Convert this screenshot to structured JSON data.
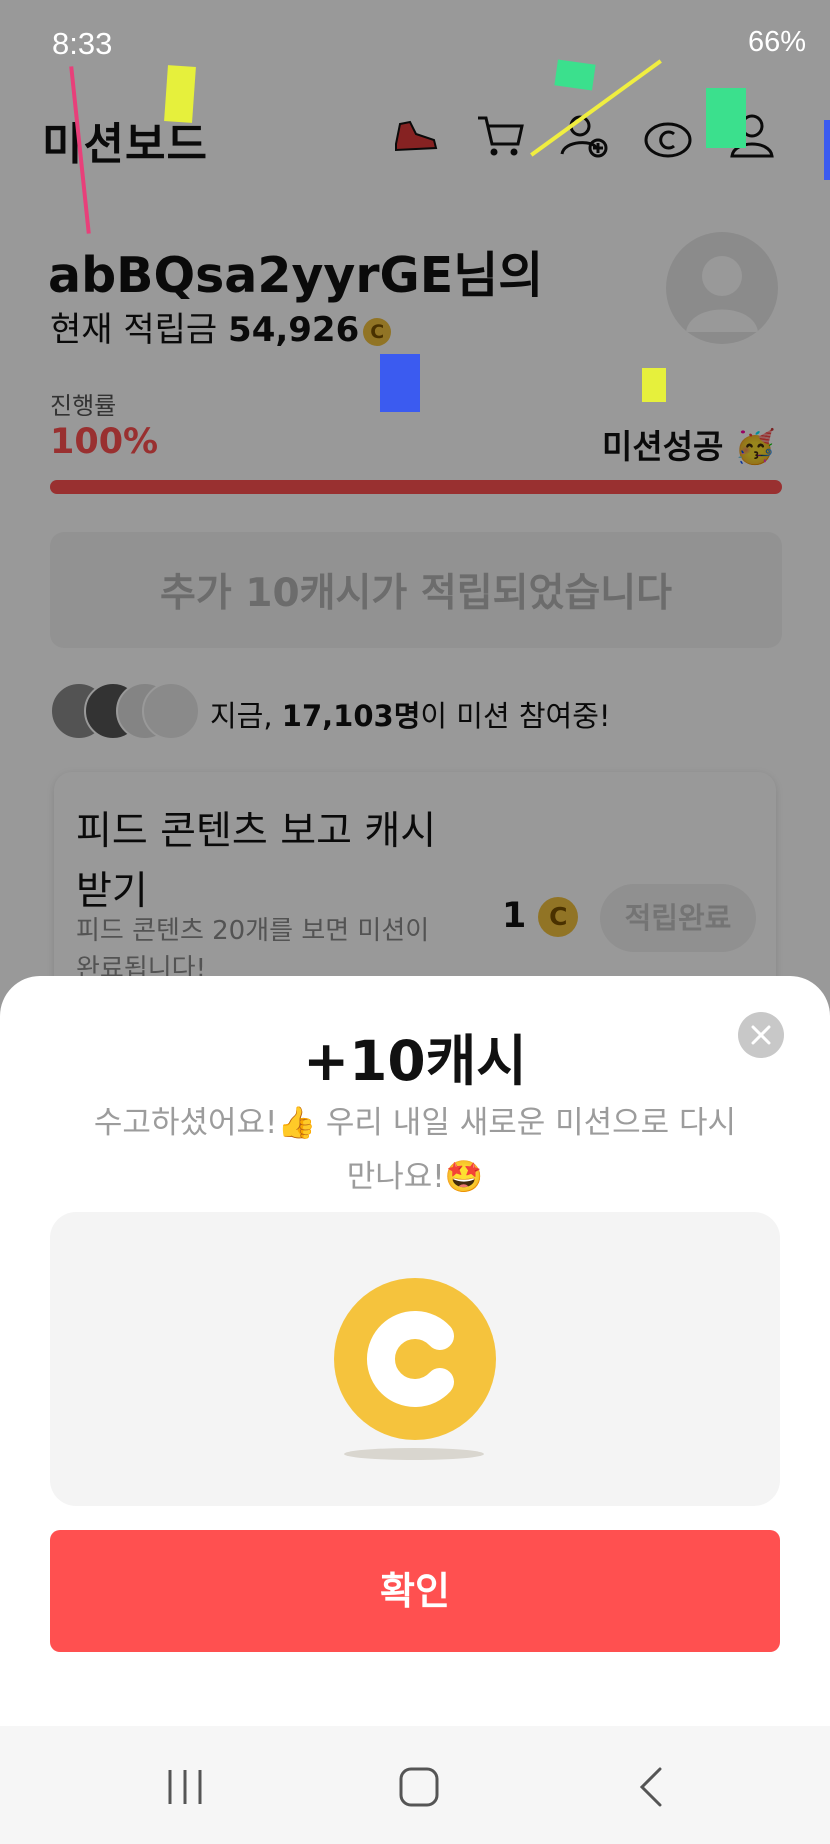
{
  "status_bar": {
    "time": "8:33",
    "battery": "66%"
  },
  "header": {
    "title": "미션보드"
  },
  "user": {
    "greeting": "abBQsa2yyrGE님의",
    "points_label": "현재 적립금",
    "points_value": "54,926"
  },
  "progress": {
    "label": "진행률",
    "value": "100%",
    "fraction": 1.0,
    "status": "미션성공 🥳"
  },
  "notice": {
    "text": "추가 10캐시가 적립되었습니다"
  },
  "participants": {
    "prefix": "지금, ",
    "count": "17,103명",
    "suffix": "이 미션 참여중!"
  },
  "mission_card": {
    "title": "피드 콘텐츠 보고 캐시 받기",
    "description": "피드 콘텐츠 20개를 보면 미션이 완료됩니다!",
    "reward": "1",
    "button_label": "적립완료"
  },
  "sheet": {
    "title": "+10캐시",
    "message": "수고하셨어요!👍 우리 내일 새로운 미션으로 다시 만나요!🤩",
    "confirm_label": "확인"
  },
  "colors": {
    "accent": "#ff5050",
    "coin": "#f5c33d"
  },
  "icons": [
    "sneaker-icon",
    "cart-icon",
    "add-friend-icon",
    "cash-icon",
    "profile-icon",
    "close-icon",
    "coin-icon"
  ]
}
